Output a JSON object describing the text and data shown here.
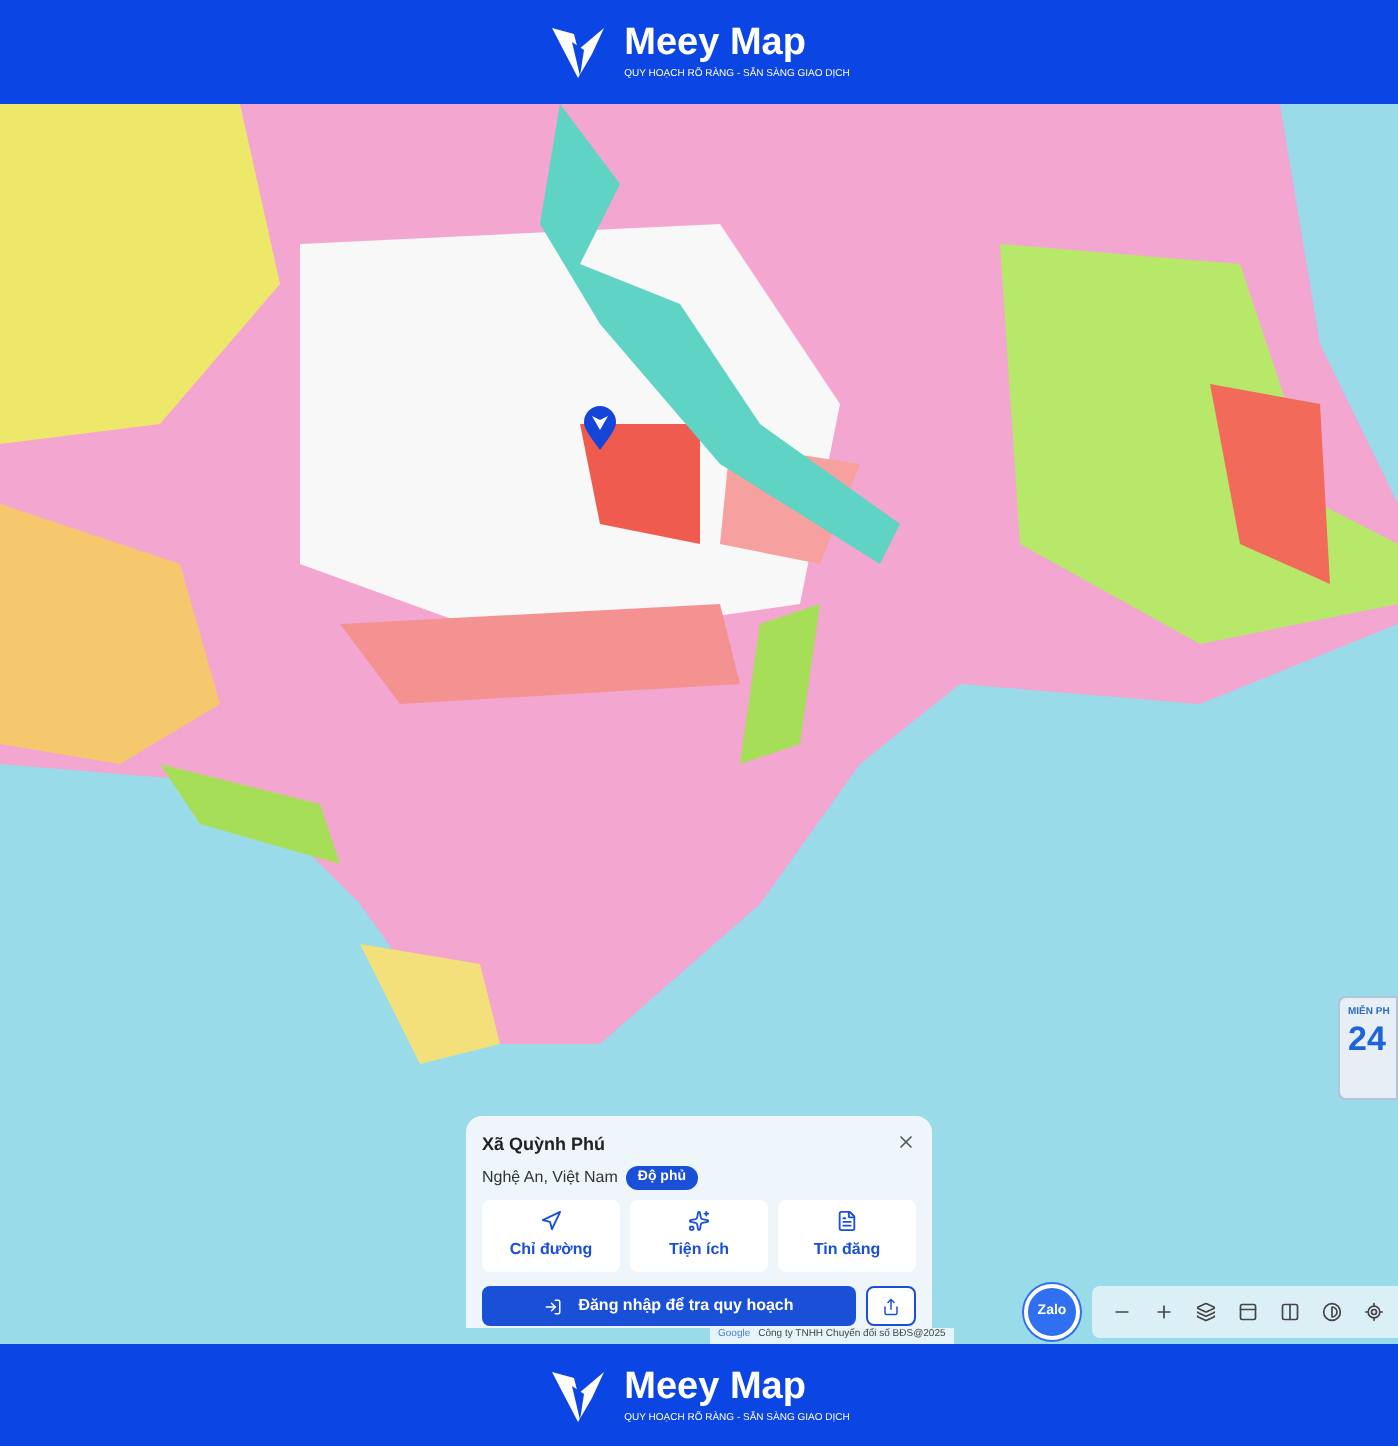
{
  "header": {
    "brand": "Meey Map",
    "tagline": "QUY HOẠCH RÕ RÀNG - SẴN SÀNG GIAO DỊCH"
  },
  "ad_widget": {
    "label": "MIỄN PH",
    "number": "24"
  },
  "place_card": {
    "title": "Xã Quỳnh Phú",
    "subtitle": "Nghệ An, Việt Nam",
    "badge": "Độ phủ",
    "actions": [
      {
        "label": "Chỉ đường",
        "kind": "directions"
      },
      {
        "label": "Tiện ích",
        "kind": "amenities"
      },
      {
        "label": "Tin đăng",
        "kind": "listings"
      }
    ],
    "login_button": "Đăng nhập để tra quy hoạch"
  },
  "attribution": {
    "provider": "Google",
    "copyright": "Công ty TNHH Chuyển đổi số BĐS@2025"
  },
  "chat_button": "Zalo",
  "map_tools": [
    {
      "kind": "zoom_out"
    },
    {
      "kind": "zoom_in"
    },
    {
      "kind": "layers"
    },
    {
      "kind": "panel"
    },
    {
      "kind": "split"
    },
    {
      "kind": "contrast"
    },
    {
      "kind": "locate"
    }
  ],
  "footer": {
    "brand": "Meey Map",
    "tagline": "QUY HOẠCH RÕ RÀNG - SẴN SÀNG GIAO DỊCH"
  }
}
